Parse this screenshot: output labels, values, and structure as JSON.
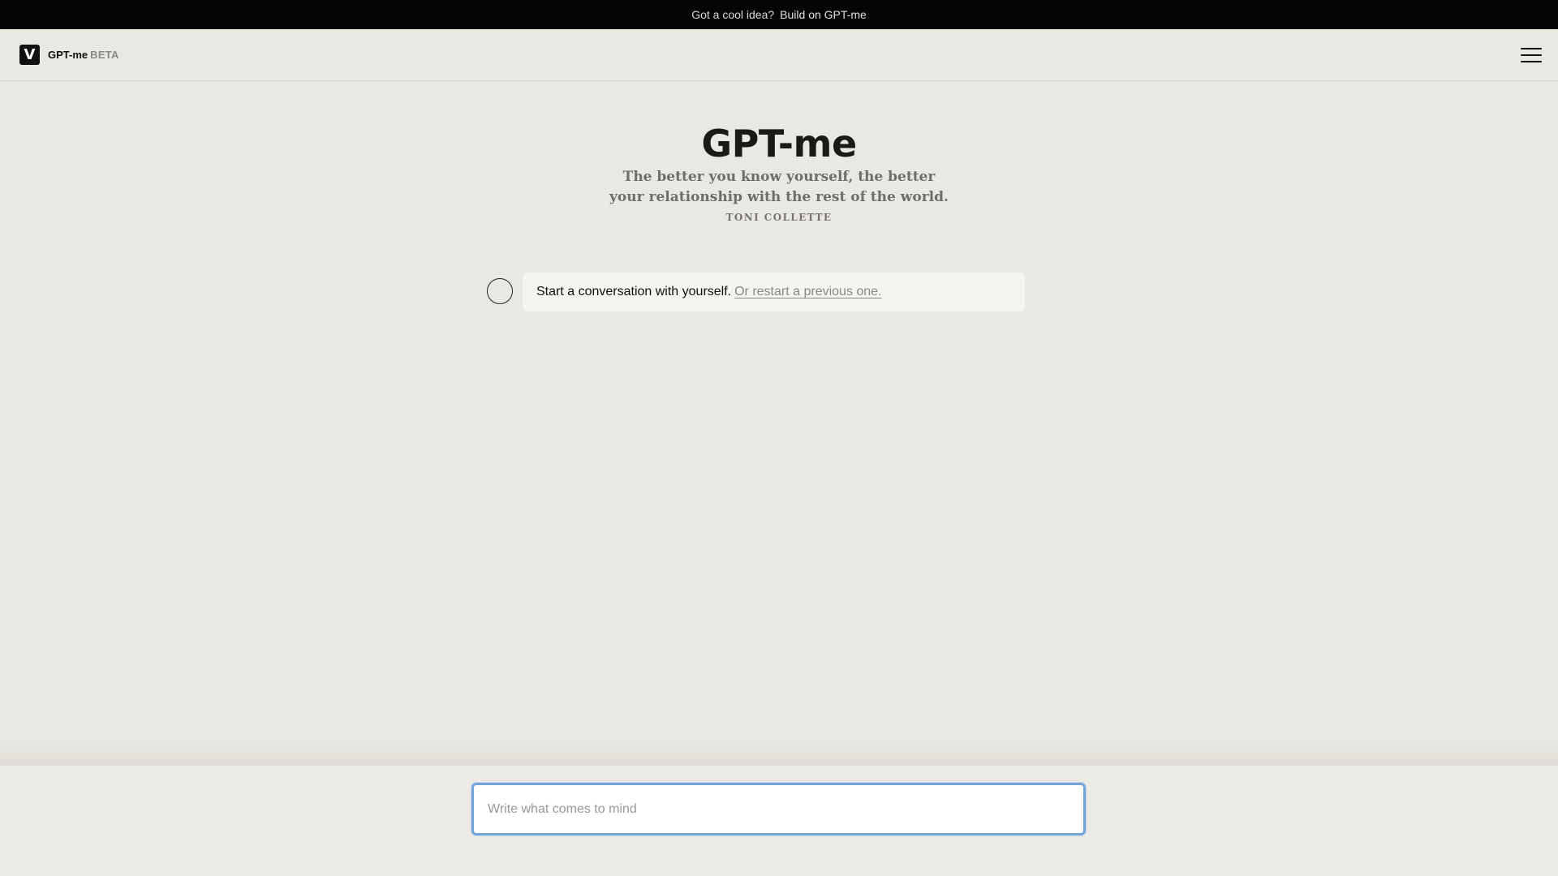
{
  "announcement": {
    "text": "Got a cool idea?",
    "link": "Build on GPT-me"
  },
  "nav": {
    "logo_letter": "V",
    "brand": "GPT-me",
    "badge": "BETA",
    "menu_icon": "hamburger-menu-icon"
  },
  "hero": {
    "title": "GPT-me",
    "quote_line1": "The better you know yourself, the better",
    "quote_line2": "your relationship with the rest of the world.",
    "attribution": "TONI COLLETTE"
  },
  "conversation": {
    "prompt": "Start a conversation with yourself.",
    "restart_link": "Or restart a previous one."
  },
  "composer": {
    "placeholder": "Write what comes to mind",
    "value": ""
  },
  "colors": {
    "background": "#e9e8e2",
    "focus_ring": "#76a4d4",
    "bar": "#050505"
  }
}
